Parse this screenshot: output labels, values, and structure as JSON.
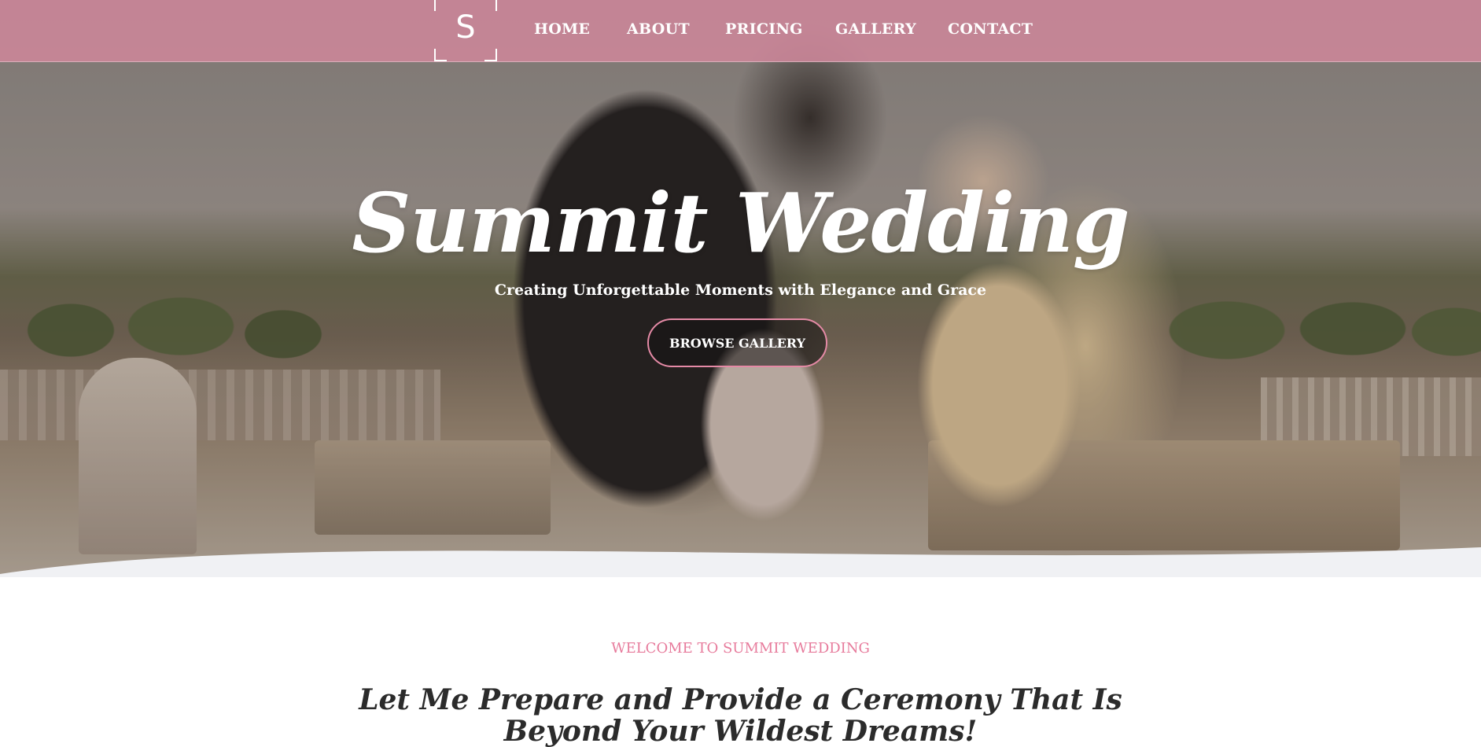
{
  "brand": {
    "logo_letter": "S"
  },
  "nav": {
    "items": [
      {
        "label": "HOME"
      },
      {
        "label": "ABOUT"
      },
      {
        "label": "PRICING"
      },
      {
        "label": "GALLERY"
      },
      {
        "label": "CONTACT"
      }
    ]
  },
  "hero": {
    "title": "Summit Wedding",
    "subtitle": "Creating Unforgettable Moments with Elegance and Grace",
    "cta_label": "BROWSE GALLERY"
  },
  "welcome": {
    "eyebrow": "WELCOME TO SUMMIT WEDDING",
    "heading": "Let Me Prepare and Provide a Ceremony That Is Beyond Your Wildest Dreams!"
  },
  "colors": {
    "nav_background": "#cd869a",
    "accent_pink": "#e77b9c",
    "button_border": "#e58aa6",
    "section_background": "#f0f1f4"
  }
}
